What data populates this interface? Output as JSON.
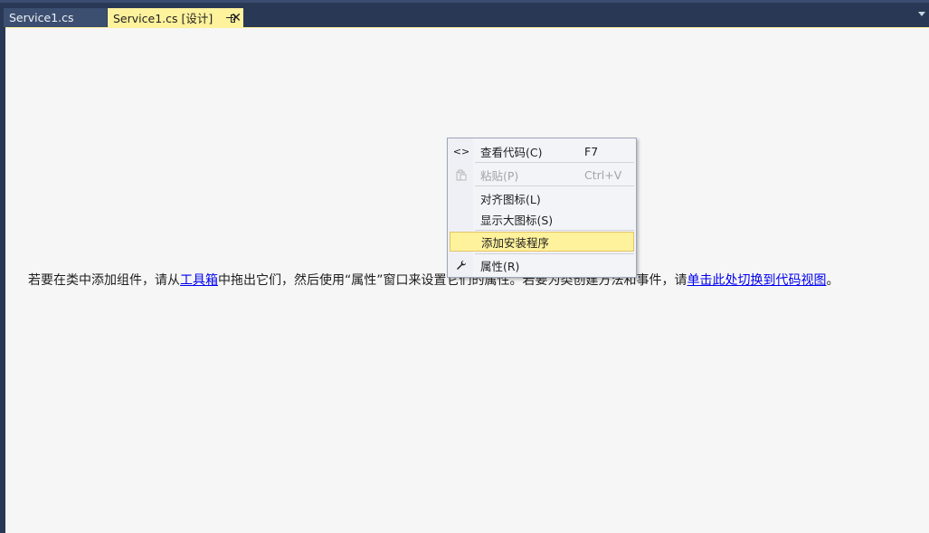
{
  "tabs": [
    {
      "label": "Service1.cs",
      "active": false
    },
    {
      "label": "Service1.cs [设计]",
      "active": true
    }
  ],
  "tab_close_glyph": "✕",
  "designer": {
    "hint_before": "若要在类中添加组件，请从",
    "toolbox_link": "工具箱",
    "hint_middle": "中拖出它们，然后使用“属性”窗口来设置它们的属性。若要为类创建方法和事件，请",
    "code_view_link": "单击此处切换到代码视图",
    "hint_end": "。"
  },
  "context_menu": {
    "items": [
      {
        "icon": "view-code-icon",
        "glyph": "<>",
        "label": "查看代码(C)",
        "shortcut": "F7",
        "enabled": true
      },
      {
        "icon": "paste-icon",
        "glyph": "",
        "label": "粘贴(P)",
        "shortcut": "Ctrl+V",
        "enabled": false
      },
      {
        "icon": "",
        "glyph": "",
        "label": "对齐图标(L)",
        "shortcut": "",
        "enabled": true
      },
      {
        "icon": "",
        "glyph": "",
        "label": "显示大图标(S)",
        "shortcut": "",
        "enabled": true
      },
      {
        "icon": "",
        "glyph": "",
        "label": "添加安装程序",
        "shortcut": "",
        "enabled": true,
        "highlighted": true
      },
      {
        "icon": "wrench-icon",
        "glyph": "🔧",
        "label": "属性(R)",
        "shortcut": "",
        "enabled": true
      }
    ]
  },
  "colors": {
    "chrome": "#293955",
    "active_tab": "#fff29d",
    "surface": "#f6f6f6",
    "link": "#0000ee"
  }
}
